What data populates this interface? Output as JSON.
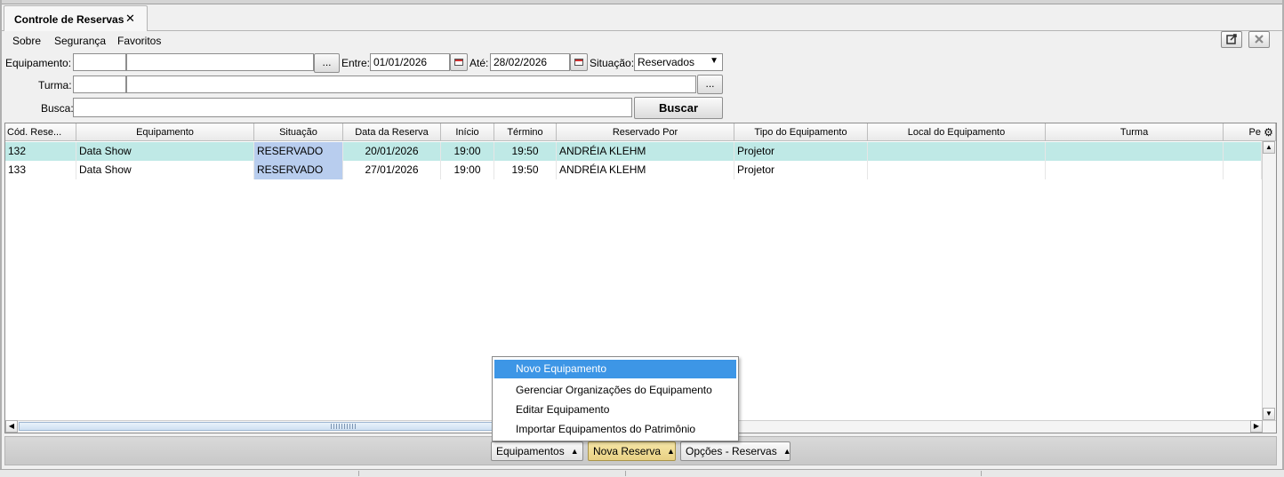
{
  "tab": {
    "title": "Controle de Reservas",
    "close": "✕"
  },
  "menu": {
    "items": [
      "Sobre",
      "Segurança",
      "Favoritos"
    ]
  },
  "filters": {
    "equipamento_label": "Equipamento:",
    "equipamento_code": "",
    "equipamento_name": "",
    "lookup_button": "...",
    "entre_label": "Entre:",
    "entre_value": "01/01/2026",
    "ate_label": "Até:",
    "ate_value": "28/02/2026",
    "situacao_label": "Situação:",
    "situacao_value": "Reservados",
    "turma_label": "Turma:",
    "turma_code": "",
    "turma_name": "",
    "busca_label": "Busca:",
    "busca_value": "",
    "buscar_button": "Buscar"
  },
  "grid": {
    "columns": [
      "Cód. Rese...",
      "Equipamento",
      "Situação",
      "Data da Reserva",
      "Início",
      "Término",
      "Reservado Por",
      "Tipo do Equipamento",
      "Local do Equipamento",
      "Turma",
      "Pe"
    ],
    "rows": [
      {
        "cod": "132",
        "equipamento": "Data Show",
        "situacao": "RESERVADO",
        "data": "20/01/2026",
        "inicio": "19:00",
        "termino": "19:50",
        "reservado_por": "ANDRÉIA KLEHM",
        "tipo": "Projetor",
        "local": "",
        "turma": ""
      },
      {
        "cod": "133",
        "equipamento": "Data Show",
        "situacao": "RESERVADO",
        "data": "27/01/2026",
        "inicio": "19:00",
        "termino": "19:50",
        "reservado_por": "ANDRÉIA KLEHM",
        "tipo": "Projetor",
        "local": "",
        "turma": ""
      }
    ]
  },
  "popup_menu": {
    "items": [
      "Novo Equipamento",
      "Gerenciar Organizações do Equipamento",
      "Editar Equipamento",
      "Importar Equipamentos do Patrimônio"
    ],
    "highlighted_index": 0
  },
  "bottom_buttons": [
    "Equipamentos",
    "Nova Reserva",
    "Opções - Reservas"
  ],
  "colors": {
    "selected_row": "#bfe9e6",
    "situacao_cell": "#b8cdee",
    "menu_highlight": "#3d96e6",
    "active_button": "#f0de97"
  }
}
